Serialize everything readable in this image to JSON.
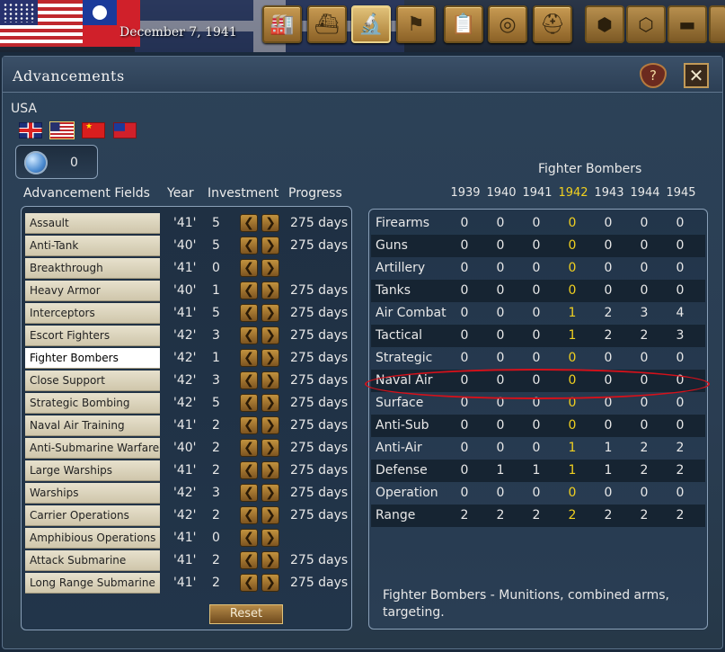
{
  "topbar": {
    "date": "December 7, 1941",
    "buttons": [
      "factory-icon",
      "ship-icon",
      "microscope-icon",
      "flag-icon",
      "clipboard-icon",
      "binoculars-icon",
      "helmet-icon",
      "hex-icon",
      "hex-cluster-icon",
      "tank-icon"
    ],
    "active_button": "microscope-icon"
  },
  "window": {
    "title": "Advancements",
    "help_label": "?",
    "close_label": "✕"
  },
  "country": {
    "name": "USA",
    "flags": [
      "uk-flag-icon",
      "us-flag-icon",
      "prc-flag-icon",
      "roc-flag-icon"
    ],
    "selected_flag": "us-flag-icon"
  },
  "points": {
    "value": "0"
  },
  "headers": {
    "fields": "Advancement Fields",
    "year": "Year",
    "investment": "Investment",
    "progress": "Progress"
  },
  "fields": [
    {
      "name": "Assault",
      "year": "'41'",
      "investment": "5",
      "progress": "275 days"
    },
    {
      "name": "Anti-Tank",
      "year": "'40'",
      "investment": "5",
      "progress": "275 days"
    },
    {
      "name": "Breakthrough",
      "year": "'41'",
      "investment": "0",
      "progress": ""
    },
    {
      "name": "Heavy Armor",
      "year": "'40'",
      "investment": "1",
      "progress": "275 days"
    },
    {
      "name": "Interceptors",
      "year": "'41'",
      "investment": "5",
      "progress": "275 days"
    },
    {
      "name": "Escort Fighters",
      "year": "'42'",
      "investment": "3",
      "progress": "275 days"
    },
    {
      "name": "Fighter Bombers",
      "year": "'42'",
      "investment": "1",
      "progress": "275 days"
    },
    {
      "name": "Close Support",
      "year": "'42'",
      "investment": "3",
      "progress": "275 days"
    },
    {
      "name": "Strategic Bombing",
      "year": "'42'",
      "investment": "5",
      "progress": "275 days"
    },
    {
      "name": "Naval Air Training",
      "year": "'41'",
      "investment": "2",
      "progress": "275 days"
    },
    {
      "name": "Anti-Submarine Warfare",
      "year": "'40'",
      "investment": "2",
      "progress": "275 days"
    },
    {
      "name": "Large Warships",
      "year": "'41'",
      "investment": "2",
      "progress": "275 days"
    },
    {
      "name": "Warships",
      "year": "'42'",
      "investment": "3",
      "progress": "275 days"
    },
    {
      "name": "Carrier Operations",
      "year": "'42'",
      "investment": "2",
      "progress": "275 days"
    },
    {
      "name": "Amphibious Operations",
      "year": "'41'",
      "investment": "0",
      "progress": ""
    },
    {
      "name": "Attack Submarine",
      "year": "'41'",
      "investment": "2",
      "progress": "275 days"
    },
    {
      "name": "Long Range Submarine",
      "year": "'41'",
      "investment": "2",
      "progress": "275 days"
    }
  ],
  "selected_field": "Fighter Bombers",
  "arrows": {
    "dec": "❮",
    "inc": "❯"
  },
  "reset_label": "Reset",
  "tech": {
    "title": "Fighter Bombers",
    "years": [
      "1939",
      "1940",
      "1941",
      "1942",
      "1943",
      "1944",
      "1945"
    ],
    "current_year": "1942",
    "rows": [
      {
        "name": "Firearms",
        "values": [
          "0",
          "0",
          "0",
          "0",
          "0",
          "0",
          "0"
        ]
      },
      {
        "name": "Guns",
        "values": [
          "0",
          "0",
          "0",
          "0",
          "0",
          "0",
          "0"
        ]
      },
      {
        "name": "Artillery",
        "values": [
          "0",
          "0",
          "0",
          "0",
          "0",
          "0",
          "0"
        ]
      },
      {
        "name": "Tanks",
        "values": [
          "0",
          "0",
          "0",
          "0",
          "0",
          "0",
          "0"
        ]
      },
      {
        "name": "Air Combat",
        "values": [
          "0",
          "0",
          "0",
          "1",
          "2",
          "3",
          "4"
        ]
      },
      {
        "name": "Tactical",
        "values": [
          "0",
          "0",
          "0",
          "1",
          "2",
          "2",
          "3"
        ]
      },
      {
        "name": "Strategic",
        "values": [
          "0",
          "0",
          "0",
          "0",
          "0",
          "0",
          "0"
        ]
      },
      {
        "name": "Naval Air",
        "values": [
          "0",
          "0",
          "0",
          "0",
          "0",
          "0",
          "0"
        ]
      },
      {
        "name": "Surface",
        "values": [
          "0",
          "0",
          "0",
          "0",
          "0",
          "0",
          "0"
        ]
      },
      {
        "name": "Anti-Sub",
        "values": [
          "0",
          "0",
          "0",
          "0",
          "0",
          "0",
          "0"
        ]
      },
      {
        "name": "Anti-Air",
        "values": [
          "0",
          "0",
          "0",
          "1",
          "1",
          "2",
          "2"
        ]
      },
      {
        "name": "Defense",
        "values": [
          "0",
          "1",
          "1",
          "1",
          "1",
          "2",
          "2"
        ]
      },
      {
        "name": "Operation",
        "values": [
          "0",
          "0",
          "0",
          "0",
          "0",
          "0",
          "0"
        ]
      },
      {
        "name": "Range",
        "values": [
          "2",
          "2",
          "2",
          "2",
          "2",
          "2",
          "2"
        ]
      }
    ],
    "highlighted_row": "Naval Air",
    "description": "Fighter Bombers - Munitions, combined arms, targeting."
  },
  "colors": {
    "current_year": "#f0d020",
    "highlight_ring": "#d6111a",
    "panel_bg": "#2a3d52"
  }
}
